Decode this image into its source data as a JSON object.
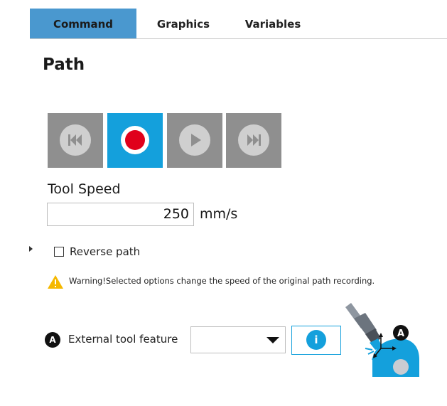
{
  "tabs": {
    "command": "Command",
    "graphics": "Graphics",
    "variables": "Variables",
    "active": "command"
  },
  "page_title": "Path",
  "controls": {
    "rewind": "rewind-icon",
    "record": "record-icon",
    "play": "play-icon",
    "fast_forward": "fast-forward-icon",
    "active": "record"
  },
  "tool_speed": {
    "label": "Tool Speed",
    "value": "250",
    "unit": "mm/s"
  },
  "reverse_path": {
    "label": "Reverse path",
    "checked": false
  },
  "warning": {
    "text": "Warning!Selected options change the speed of the original path recording."
  },
  "external_tool": {
    "badge": "A",
    "label": "External tool feature",
    "selected": "",
    "info_label": "i"
  },
  "illustration": {
    "badge": "A",
    "icon": "robot-tool-feature-illustration"
  },
  "colors": {
    "accent": "#14a0dc",
    "tab_active": "#4a98cf",
    "record": "#e0001b",
    "button_gray": "#8f8f8f",
    "warning": "#f5b800"
  }
}
